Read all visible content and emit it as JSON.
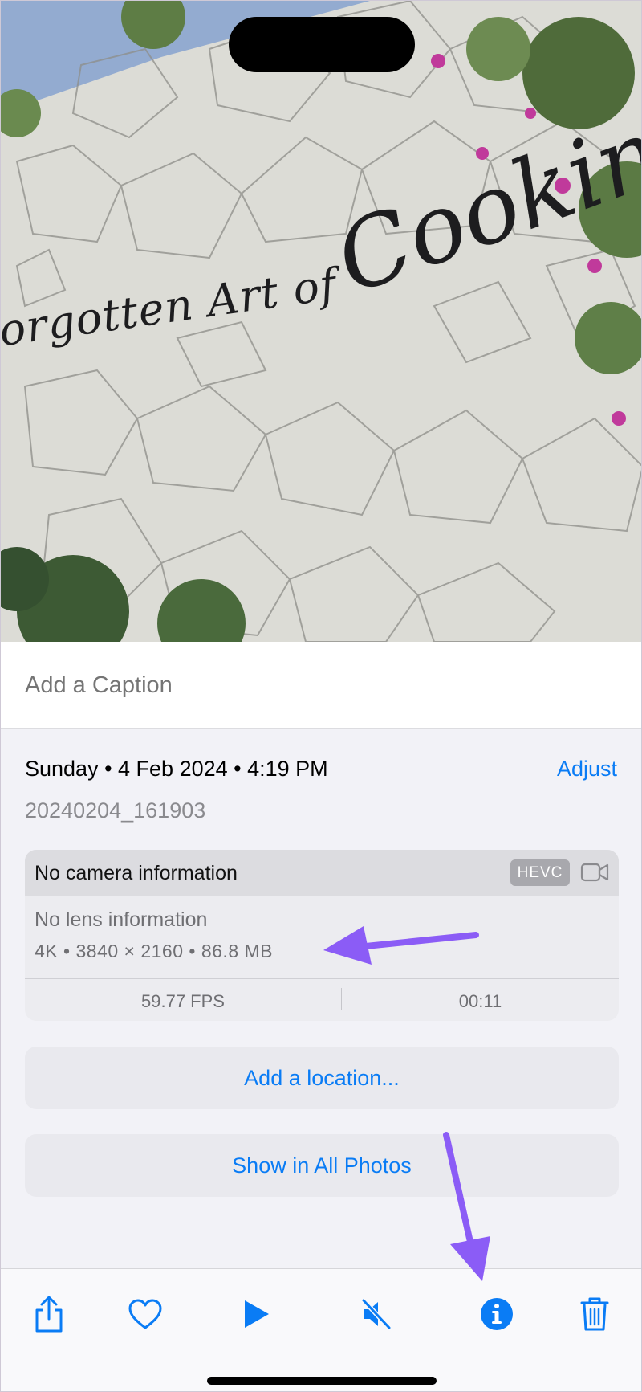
{
  "photo": {
    "sign_text": "orgotten Art of",
    "sign_script": "Cooking"
  },
  "caption": {
    "placeholder": "Add a Caption"
  },
  "info": {
    "datetime": "Sunday • 4 Feb 2024 • 4:19 PM",
    "adjust_label": "Adjust",
    "filename": "20240204_161903"
  },
  "metadata_card": {
    "camera": "No camera information",
    "format_badge": "HEVC",
    "format_icon": "video-camera-icon",
    "lens": "No lens information",
    "specs": "4K  •  3840 × 2160  •  86.8 MB",
    "fps": "59.77 FPS",
    "duration": "00:11"
  },
  "actions": {
    "add_location": "Add a location...",
    "show_all": "Show in All Photos"
  },
  "toolbar": {
    "items": [
      "share-icon",
      "heart-icon",
      "play-icon",
      "mute-icon",
      "info-icon",
      "trash-icon"
    ]
  },
  "colors": {
    "accent": "#0a7cf5",
    "annotation_arrow": "#8b5cf6"
  }
}
